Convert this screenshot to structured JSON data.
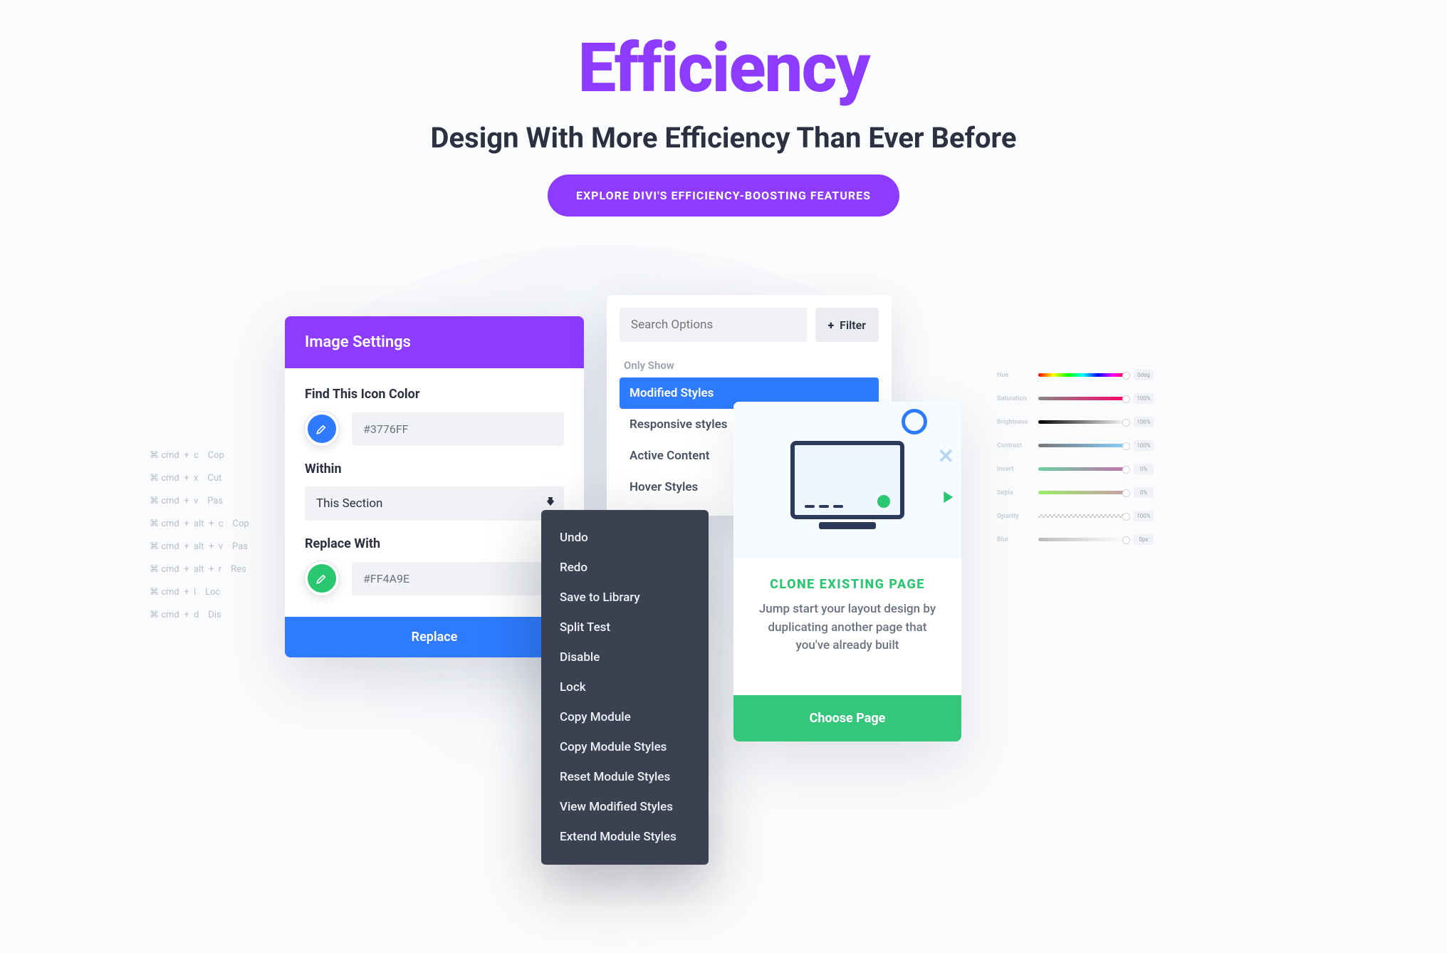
{
  "hero": {
    "title": "Efficiency",
    "subtitle": "Design With More Efficiency Than Ever Before",
    "cta": "EXPLORE DIVI'S EFFICIENCY-BOOSTING FEATURES"
  },
  "shortcuts": [
    "⌘ cmd  +  c    Cop",
    "⌘ cmd  +  x    Cut",
    "⌘ cmd  +  v    Pas",
    "⌘ cmd  +  alt  +  c    Cop",
    "⌘ cmd  +  alt  +  v    Pas",
    "⌘ cmd  +  alt  +  r    Res",
    "⌘ cmd  +  l    Loc",
    "⌘ cmd  +  d    Dis"
  ],
  "imageSettings": {
    "header": "Image Settings",
    "findLabel": "Find This Icon Color",
    "findValue": "#3776FF",
    "withinLabel": "Within",
    "withinValue": "This Section",
    "replaceLabel": "Replace With",
    "replaceValue": "#FF4A9E",
    "buttonLabel": "Replace"
  },
  "search": {
    "placeholder": "Search Options",
    "filterLabel": "Filter",
    "sectionLabel": "Only Show",
    "options": [
      "Modified Styles",
      "Responsive styles",
      "Active Content",
      "Hover Styles"
    ],
    "activeIndex": 0
  },
  "contextMenu": [
    "Undo",
    "Redo",
    "Save to Library",
    "Split Test",
    "Disable",
    "Lock",
    "Copy Module",
    "Copy Module Styles",
    "Reset Module Styles",
    "View Modified Styles",
    "Extend Module Styles"
  ],
  "clone": {
    "title": "CLONE EXISTING PAGE",
    "desc": "Jump start your layout design by duplicating another page that you've already built",
    "button": "Choose Page"
  },
  "sliders": [
    {
      "label": "Hue",
      "gradient": "linear-gradient(90deg,red,yellow,lime,cyan,blue,magenta,red)",
      "val": "0deg"
    },
    {
      "label": "Saturation",
      "gradient": "linear-gradient(90deg,#888,#ff0066)",
      "val": "100%"
    },
    {
      "label": "Brightness",
      "gradient": "linear-gradient(90deg,#000,#fff)",
      "val": "100%"
    },
    {
      "label": "Contrast",
      "gradient": "linear-gradient(90deg,#777,#88d0ff)",
      "val": "100%"
    },
    {
      "label": "Invert",
      "gradient": "linear-gradient(90deg,#6ad0a0,#c86fae)",
      "val": "0%"
    },
    {
      "label": "Sepia",
      "gradient": "linear-gradient(90deg,#9e6,#c9a)",
      "val": "0%"
    },
    {
      "label": "Opacity",
      "gradient": "repeating-conic-gradient(#ccc 0 25%,#fff 0 50%) 0/6px 6px",
      "val": "100%"
    },
    {
      "label": "Blur",
      "gradient": "linear-gradient(90deg,#bbb,#fff)",
      "val": "0px"
    }
  ]
}
